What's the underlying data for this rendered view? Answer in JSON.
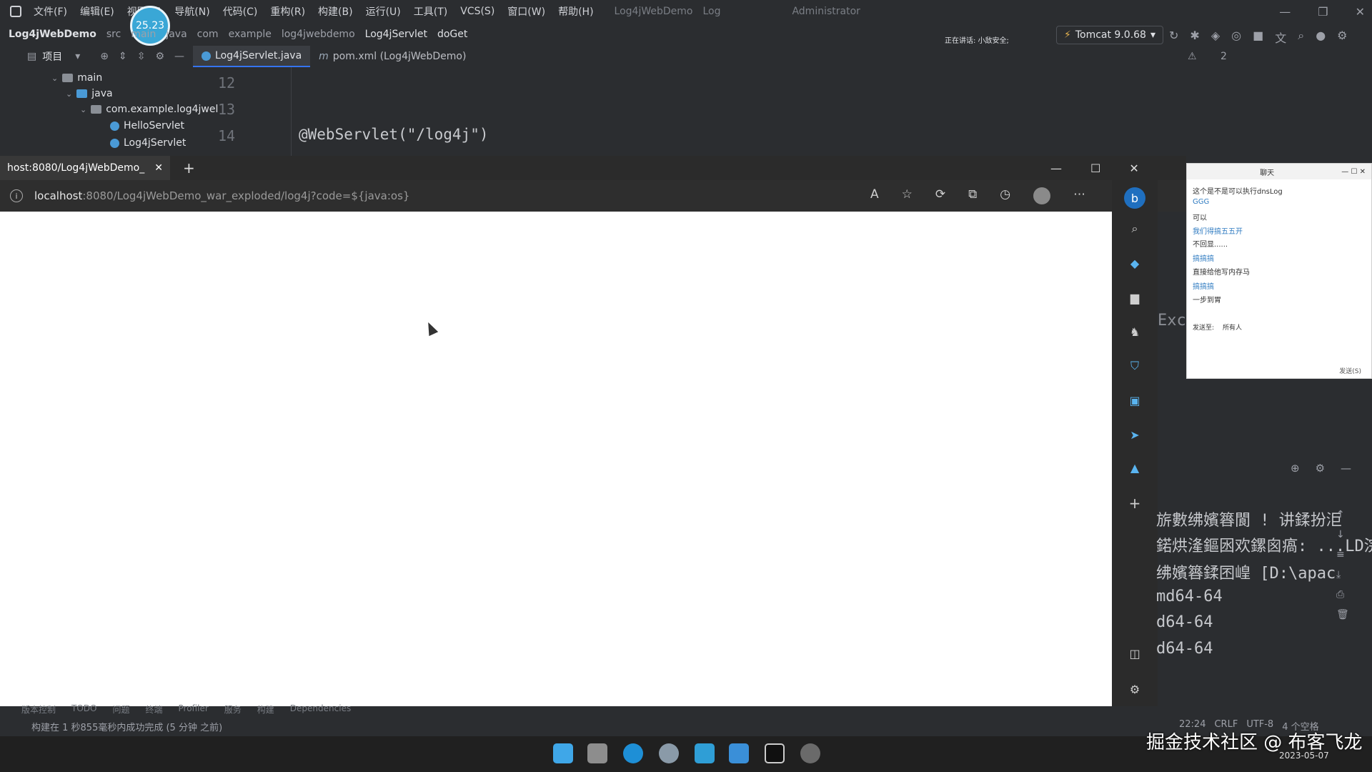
{
  "ide": {
    "menu": [
      "文件(F)",
      "编辑(E)",
      "视图(V)",
      "导航(N)",
      "代码(C)",
      "重构(R)",
      "构建(B)",
      "运行(U)",
      "工具(T)",
      "VCS(S)",
      "窗口(W)",
      "帮助(H)"
    ],
    "window_title": "Log4jWebDemo",
    "title_suffix": "Log",
    "title_user": "Administrator",
    "breadcrumb": [
      "Log4jWebDemo",
      "src",
      "main",
      "java",
      "com",
      "example",
      "log4jwebdemo",
      "Log4jServlet",
      "doGet"
    ],
    "run_config": "Tomcat 9.0.68",
    "project_label": "项目",
    "meeting_text": "正在讲话: 小敌安全;",
    "editor_tabs": [
      {
        "label": "Log4jServlet.java",
        "active": true
      },
      {
        "label": "pom.xml (Log4jWebDemo)",
        "active": false
      }
    ],
    "inspection_count": "2",
    "tree": [
      {
        "label": "main",
        "type": "folder"
      },
      {
        "label": "java",
        "type": "folder"
      },
      {
        "label": "com.example.log4jwel",
        "type": "package"
      },
      {
        "label": "HelloServlet",
        "type": "class"
      },
      {
        "label": "Log4jServlet",
        "type": "class"
      }
    ],
    "line_numbers": [
      "12",
      "13",
      "14"
    ],
    "code_line_14": "@WebServlet(\"/log4j\")",
    "console_fragment": "Exc",
    "console_lines": [
      "旂數绋嬪簭閬 ! 讲鍒扮洰",
      "鍩烘湰鏂囦欢鏍囪瘑: ...LD浣嗗簱鍏",
      "绋嬪簭鍒囨崲 [D:\\apac",
      "md64-64",
      "d64-64",
      "d64-64"
    ],
    "tool_tabs": [
      "版本控制",
      "TODO",
      "问题",
      "终端",
      "Profiler",
      "服务",
      "构建",
      "Dependencies"
    ],
    "status_message": "构建在 1 秒855毫秒内成功完成 (5 分钟 之前)",
    "status_right": [
      "22:24",
      "CRLF",
      "UTF-8",
      "4 个空格"
    ],
    "avatar_badge": "25.23"
  },
  "browser": {
    "tab_title": "host:8080/Log4jWebDemo_",
    "url_host": "localhost",
    "url_rest": ":8080/Log4jWebDemo_war_exploded/log4j?code=${java:os}"
  },
  "chat": {
    "title": "聊天",
    "messages": [
      {
        "text": "这个是不是可以执行dnsLog",
        "style": "user"
      },
      {
        "text": "GGG",
        "style": "alt"
      },
      {
        "text": "可以",
        "style": "user"
      },
      {
        "text": "我们得搞五五开",
        "style": "alt"
      },
      {
        "text": "不回显......",
        "style": "user"
      },
      {
        "text": "搞搞搞",
        "style": "alt"
      },
      {
        "text": "直接给他写内存马",
        "style": "user"
      },
      {
        "text": "搞搞搞",
        "style": "alt"
      },
      {
        "text": "一步到胃",
        "style": "user"
      }
    ],
    "send_to_label": "发送至:",
    "send_to_value": "所有人",
    "send_button": "发送(S)"
  },
  "taskbar": {
    "date": "2023-05-07"
  },
  "watermark": "掘金技术社区 @ 布客飞龙"
}
